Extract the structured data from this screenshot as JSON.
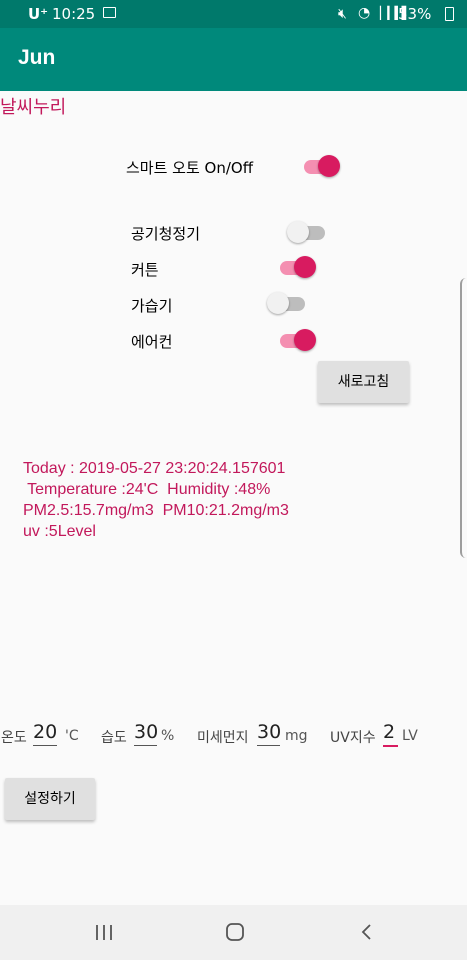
{
  "status_bar": {
    "carrier": "U⁺",
    "time": "10:25",
    "battery": "53%",
    "icons": [
      "image-icon",
      "mute-icon",
      "wifi-icon",
      "signal-icon",
      "battery-icon"
    ]
  },
  "app_bar": {
    "title": "Jun"
  },
  "app_label": "날씨누리",
  "smart_auto": {
    "label": "스마트 오토 On/Off",
    "on": true
  },
  "devices": [
    {
      "label": "공기청정기",
      "on": false
    },
    {
      "label": "커튼",
      "on": true
    },
    {
      "label": "가습기",
      "on": false
    },
    {
      "label": "에어컨",
      "on": true
    }
  ],
  "refresh_button": "새로고침",
  "info": {
    "line1": "Today : 2019-05-27 23:20:24.157601",
    "line2": " Temperature :24'C  Humidity :48%",
    "line3": "PM2.5:15.7mg/m3  PM10:21.2mg/m3",
    "line4": "uv :5Level"
  },
  "settings": {
    "temp_label": "온도",
    "temp_value": "20",
    "temp_unit": "'C",
    "humidity_label": "습도",
    "humidity_value": "30",
    "humidity_unit": "%",
    "dust_label": "미세먼지",
    "dust_value": "30",
    "dust_unit": "mg",
    "uv_label": "UV지수",
    "uv_value": "2",
    "uv_unit": "LV"
  },
  "set_button": "설정하기",
  "colors": {
    "appbar": "#00897b",
    "statusbar": "#00796b",
    "accent": "#d81b60",
    "text_accent": "#c2185b"
  }
}
